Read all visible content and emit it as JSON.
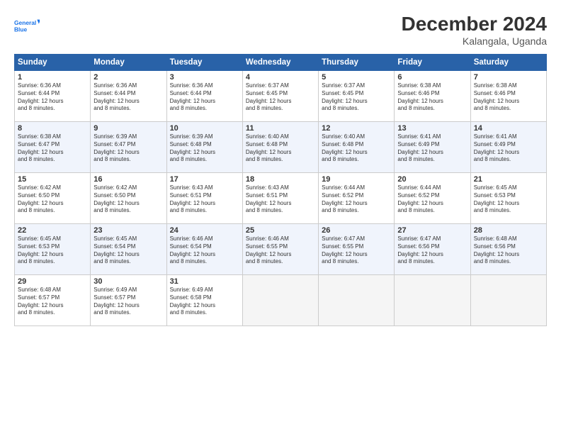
{
  "logo": {
    "line1": "General",
    "line2": "Blue"
  },
  "title": "December 2024",
  "subtitle": "Kalangala, Uganda",
  "days_header": [
    "Sunday",
    "Monday",
    "Tuesday",
    "Wednesday",
    "Thursday",
    "Friday",
    "Saturday"
  ],
  "weeks": [
    [
      {
        "day": "1",
        "info": "Sunrise: 6:36 AM\nSunset: 6:44 PM\nDaylight: 12 hours\nand 8 minutes."
      },
      {
        "day": "2",
        "info": "Sunrise: 6:36 AM\nSunset: 6:44 PM\nDaylight: 12 hours\nand 8 minutes."
      },
      {
        "day": "3",
        "info": "Sunrise: 6:36 AM\nSunset: 6:44 PM\nDaylight: 12 hours\nand 8 minutes."
      },
      {
        "day": "4",
        "info": "Sunrise: 6:37 AM\nSunset: 6:45 PM\nDaylight: 12 hours\nand 8 minutes."
      },
      {
        "day": "5",
        "info": "Sunrise: 6:37 AM\nSunset: 6:45 PM\nDaylight: 12 hours\nand 8 minutes."
      },
      {
        "day": "6",
        "info": "Sunrise: 6:38 AM\nSunset: 6:46 PM\nDaylight: 12 hours\nand 8 minutes."
      },
      {
        "day": "7",
        "info": "Sunrise: 6:38 AM\nSunset: 6:46 PM\nDaylight: 12 hours\nand 8 minutes."
      }
    ],
    [
      {
        "day": "8",
        "info": "Sunrise: 6:38 AM\nSunset: 6:47 PM\nDaylight: 12 hours\nand 8 minutes."
      },
      {
        "day": "9",
        "info": "Sunrise: 6:39 AM\nSunset: 6:47 PM\nDaylight: 12 hours\nand 8 minutes."
      },
      {
        "day": "10",
        "info": "Sunrise: 6:39 AM\nSunset: 6:48 PM\nDaylight: 12 hours\nand 8 minutes."
      },
      {
        "day": "11",
        "info": "Sunrise: 6:40 AM\nSunset: 6:48 PM\nDaylight: 12 hours\nand 8 minutes."
      },
      {
        "day": "12",
        "info": "Sunrise: 6:40 AM\nSunset: 6:48 PM\nDaylight: 12 hours\nand 8 minutes."
      },
      {
        "day": "13",
        "info": "Sunrise: 6:41 AM\nSunset: 6:49 PM\nDaylight: 12 hours\nand 8 minutes."
      },
      {
        "day": "14",
        "info": "Sunrise: 6:41 AM\nSunset: 6:49 PM\nDaylight: 12 hours\nand 8 minutes."
      }
    ],
    [
      {
        "day": "15",
        "info": "Sunrise: 6:42 AM\nSunset: 6:50 PM\nDaylight: 12 hours\nand 8 minutes."
      },
      {
        "day": "16",
        "info": "Sunrise: 6:42 AM\nSunset: 6:50 PM\nDaylight: 12 hours\nand 8 minutes."
      },
      {
        "day": "17",
        "info": "Sunrise: 6:43 AM\nSunset: 6:51 PM\nDaylight: 12 hours\nand 8 minutes."
      },
      {
        "day": "18",
        "info": "Sunrise: 6:43 AM\nSunset: 6:51 PM\nDaylight: 12 hours\nand 8 minutes."
      },
      {
        "day": "19",
        "info": "Sunrise: 6:44 AM\nSunset: 6:52 PM\nDaylight: 12 hours\nand 8 minutes."
      },
      {
        "day": "20",
        "info": "Sunrise: 6:44 AM\nSunset: 6:52 PM\nDaylight: 12 hours\nand 8 minutes."
      },
      {
        "day": "21",
        "info": "Sunrise: 6:45 AM\nSunset: 6:53 PM\nDaylight: 12 hours\nand 8 minutes."
      }
    ],
    [
      {
        "day": "22",
        "info": "Sunrise: 6:45 AM\nSunset: 6:53 PM\nDaylight: 12 hours\nand 8 minutes."
      },
      {
        "day": "23",
        "info": "Sunrise: 6:45 AM\nSunset: 6:54 PM\nDaylight: 12 hours\nand 8 minutes."
      },
      {
        "day": "24",
        "info": "Sunrise: 6:46 AM\nSunset: 6:54 PM\nDaylight: 12 hours\nand 8 minutes."
      },
      {
        "day": "25",
        "info": "Sunrise: 6:46 AM\nSunset: 6:55 PM\nDaylight: 12 hours\nand 8 minutes."
      },
      {
        "day": "26",
        "info": "Sunrise: 6:47 AM\nSunset: 6:55 PM\nDaylight: 12 hours\nand 8 minutes."
      },
      {
        "day": "27",
        "info": "Sunrise: 6:47 AM\nSunset: 6:56 PM\nDaylight: 12 hours\nand 8 minutes."
      },
      {
        "day": "28",
        "info": "Sunrise: 6:48 AM\nSunset: 6:56 PM\nDaylight: 12 hours\nand 8 minutes."
      }
    ],
    [
      {
        "day": "29",
        "info": "Sunrise: 6:48 AM\nSunset: 6:57 PM\nDaylight: 12 hours\nand 8 minutes."
      },
      {
        "day": "30",
        "info": "Sunrise: 6:49 AM\nSunset: 6:57 PM\nDaylight: 12 hours\nand 8 minutes."
      },
      {
        "day": "31",
        "info": "Sunrise: 6:49 AM\nSunset: 6:58 PM\nDaylight: 12 hours\nand 8 minutes."
      },
      null,
      null,
      null,
      null
    ]
  ]
}
